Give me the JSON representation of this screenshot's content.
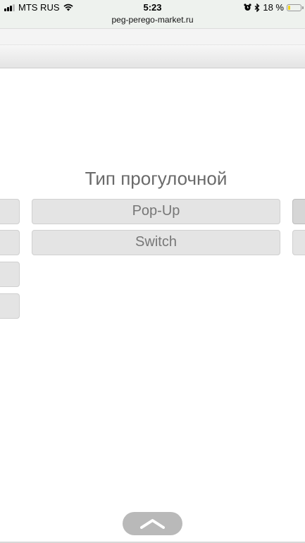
{
  "status_bar": {
    "carrier": "MTS RUS",
    "time": "5:23",
    "url": "peg-perego-market.ru",
    "battery_text": "18 %",
    "battery_level": 0.18,
    "battery_color": "#f2d31b",
    "icons": [
      "signal-icon",
      "wifi-icon",
      "alarm-icon",
      "bluetooth-icon",
      "battery-icon"
    ]
  },
  "filter": {
    "title": "Тип прогулочной",
    "options": [
      {
        "label": "Pop-Up"
      },
      {
        "label": "Switch"
      }
    ]
  },
  "scroll_top": {
    "icon": "chevron-up-icon"
  }
}
